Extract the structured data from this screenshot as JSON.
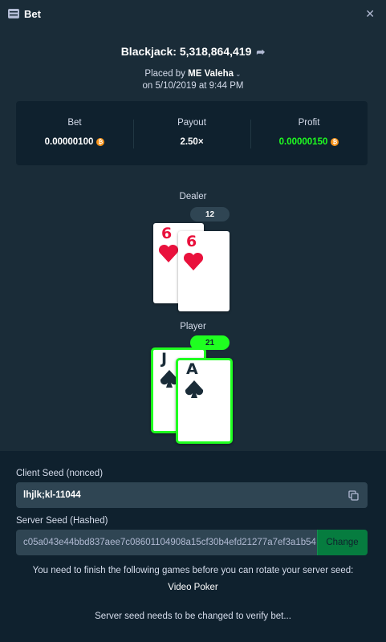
{
  "header": {
    "title": "Bet",
    "icon": "bet-icon",
    "close_icon": "close-icon"
  },
  "game": {
    "title": "Blackjack: 5,318,864,419",
    "share_icon": "share-icon",
    "placed_prefix": "Placed by",
    "user": "ME Valeha",
    "date": "on 5/10/2019 at 9:44 PM"
  },
  "summary": {
    "bet_label": "Bet",
    "bet_value": "0.00000100",
    "payout_label": "Payout",
    "payout_value": "2.50×",
    "profit_label": "Profit",
    "profit_value": "0.00000150",
    "currency_icon": "bitcoin-icon"
  },
  "dealer": {
    "label": "Dealer",
    "score": "12",
    "cards": [
      {
        "rank": "6",
        "suit": "hearts"
      },
      {
        "rank": "6",
        "suit": "hearts"
      }
    ]
  },
  "player": {
    "label": "Player",
    "score": "21",
    "cards": [
      {
        "rank": "J",
        "suit": "spades"
      },
      {
        "rank": "A",
        "suit": "spades"
      }
    ]
  },
  "seeds": {
    "client_label": "Client Seed (nonced)",
    "client_value": "lhjlk;kl-11044",
    "server_label": "Server Seed (Hashed)",
    "server_value": "c05a043e44bbd837aee7c08601104908a15cf30b4efd21277a7ef3a1b54",
    "change_label": "Change",
    "rotate_note": "You need to finish the following games before you can rotate your server seed:",
    "pending_game": "Video Poker",
    "verify_note": "Server seed needs to be changed to verify bet..."
  },
  "colors": {
    "background": "#1a2c38",
    "panel": "#0f212e",
    "green": "#1fff20",
    "red": "#e9113c",
    "coin": "#f7931a"
  }
}
